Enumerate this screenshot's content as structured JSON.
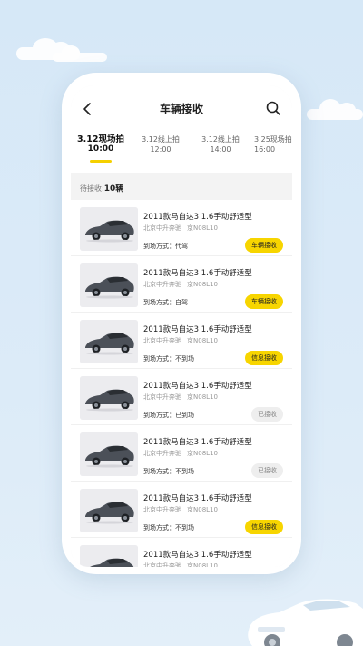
{
  "header": {
    "title": "车辆接收",
    "back_icon": "chevron-left-icon",
    "search_icon": "search-icon"
  },
  "tabs": [
    {
      "line1": "3.12现场拍",
      "line2": "10:00",
      "active": true
    },
    {
      "line1": "3.12线上拍",
      "line2": "12:00",
      "active": false
    },
    {
      "line1": "3.12线上拍",
      "line2": "14:00",
      "active": false
    },
    {
      "line1": "3.25现场拍",
      "line2": "16:00",
      "active": false
    }
  ],
  "pending": {
    "label": "待接收:",
    "count": "10辆"
  },
  "cards": [
    {
      "name": "2011款马自达3 1.6手动舒适型",
      "dealer": "北京中升奔驰",
      "plate": "京N08L10",
      "mode": "到场方式：代驾",
      "action": "车辆接收",
      "done": false
    },
    {
      "name": "2011款马自达3 1.6手动舒适型",
      "dealer": "北京中升奔驰",
      "plate": "京N08L10",
      "mode": "到场方式：自驾",
      "action": "车辆接收",
      "done": false
    },
    {
      "name": "2011款马自达3 1.6手动舒适型",
      "dealer": "北京中升奔驰",
      "plate": "京N08L10",
      "mode": "到场方式：不到场",
      "action": "信息接收",
      "done": false
    },
    {
      "name": "2011款马自达3 1.6手动舒适型",
      "dealer": "北京中升奔驰",
      "plate": "京N08L10",
      "mode": "到场方式：已到场",
      "action": "已接收",
      "done": true
    },
    {
      "name": "2011款马自达3 1.6手动舒适型",
      "dealer": "北京中升奔驰",
      "plate": "京N08L10",
      "mode": "到场方式：不到场",
      "action": "已接收",
      "done": true
    },
    {
      "name": "2011款马自达3 1.6手动舒适型",
      "dealer": "北京中升奔驰",
      "plate": "京N08L10",
      "mode": "到场方式：不到场",
      "action": "信息接收",
      "done": false
    },
    {
      "name": "2011款马自达3 1.6手动舒适型",
      "dealer": "北京中升奔驰",
      "plate": "京N08L10",
      "mode": "",
      "action": "",
      "done": false
    }
  ],
  "colors": {
    "accent": "#f7d500",
    "background": "#d6e8f7"
  }
}
